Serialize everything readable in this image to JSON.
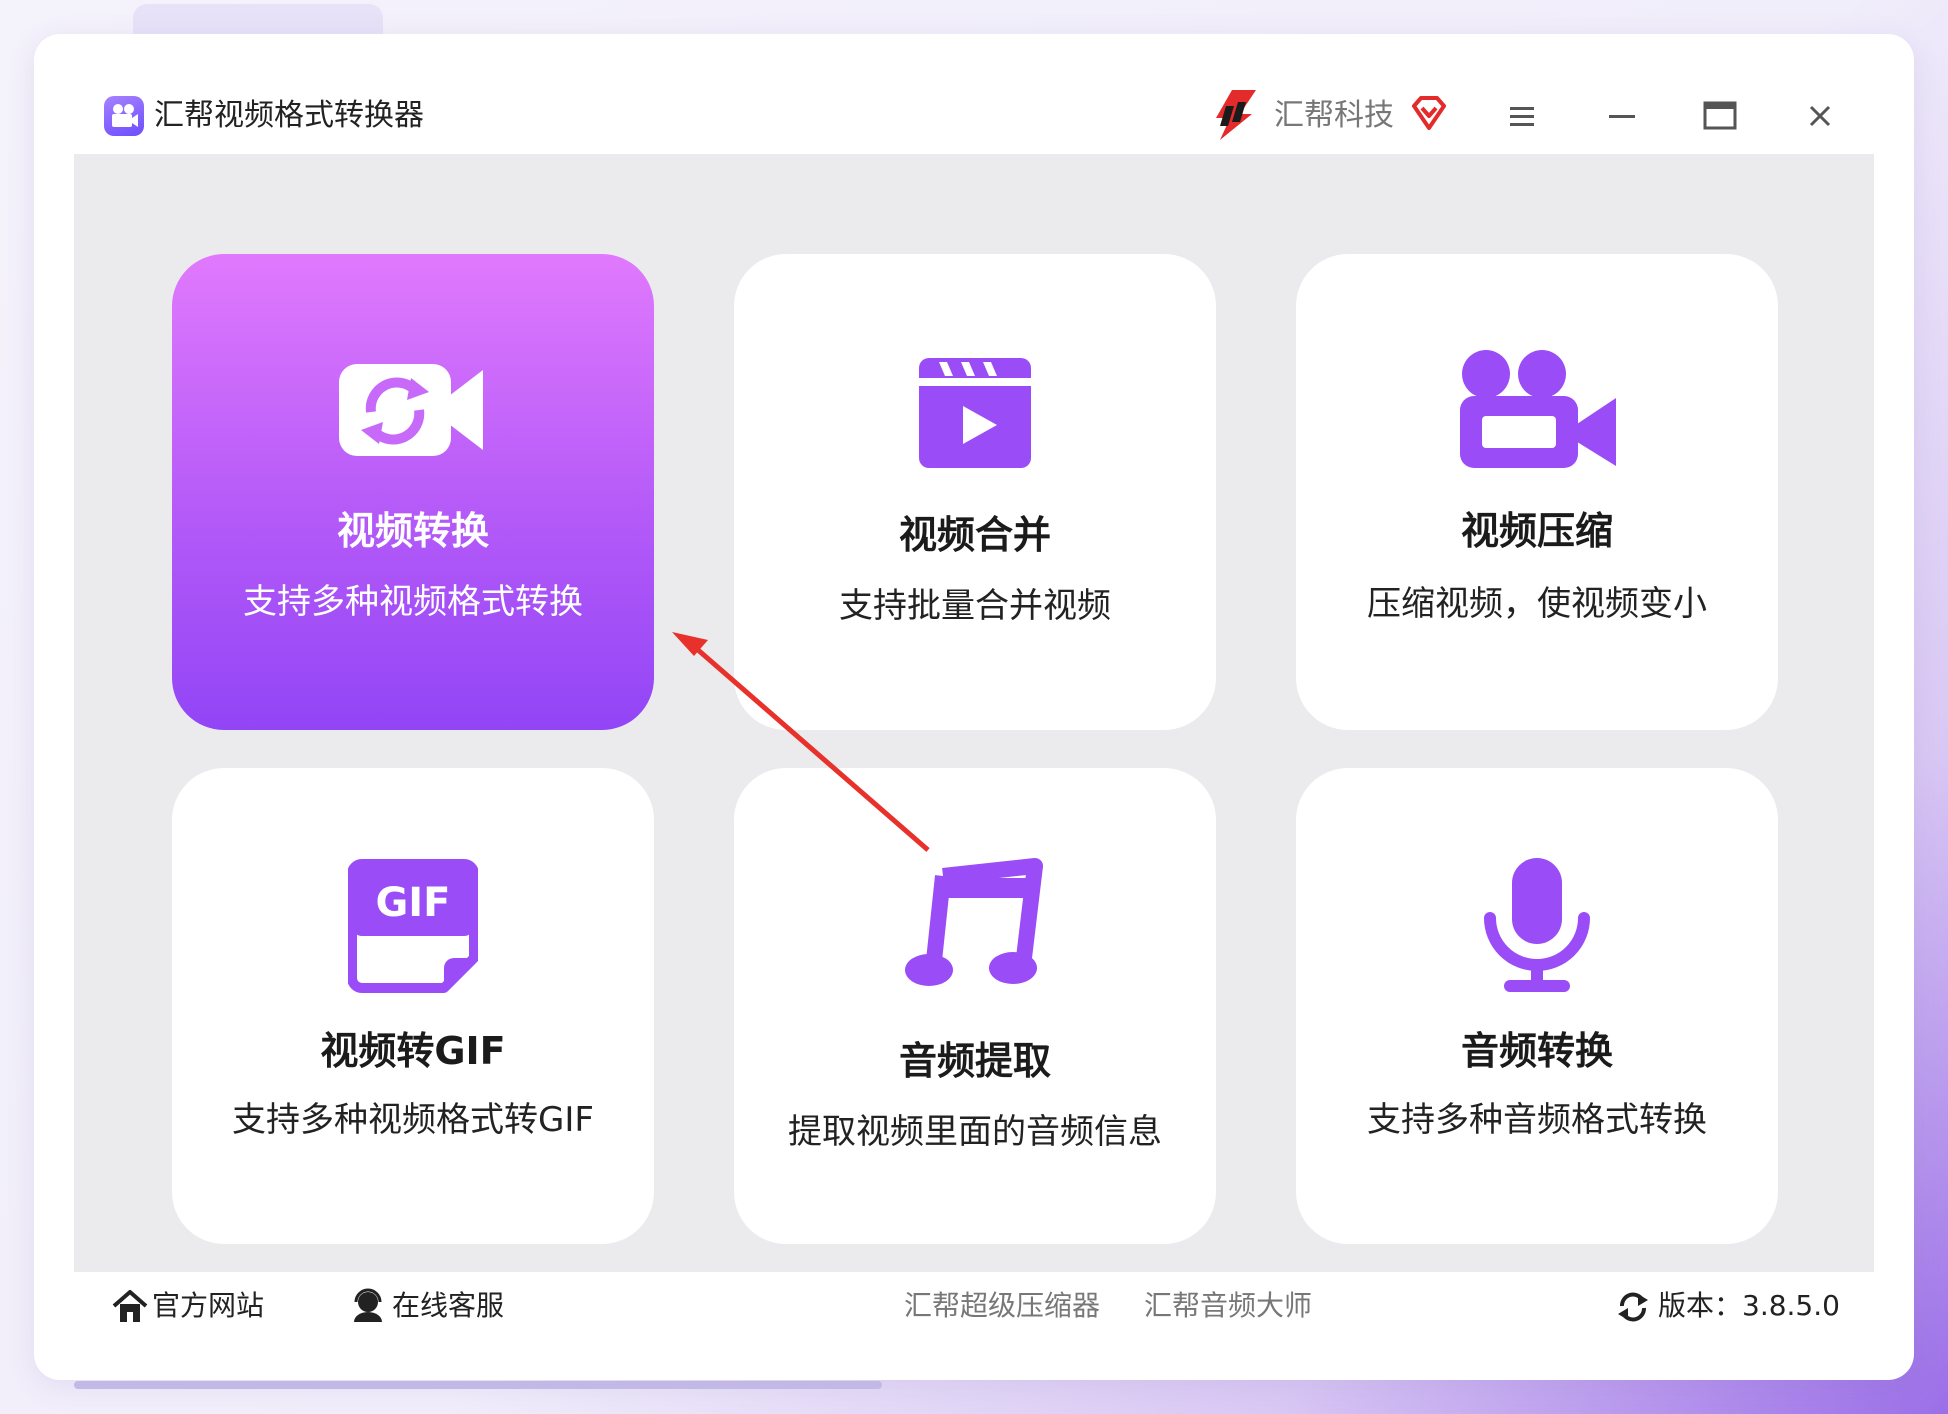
{
  "app": {
    "title": "汇帮视频格式转换器",
    "brand": "汇帮科技"
  },
  "colors": {
    "accent": "#9a4cf7",
    "active_card_top": "#e079fd",
    "active_card_bottom": "#9245f6",
    "annotation_arrow": "#e8312a"
  },
  "window_controls": [
    "menu-icon",
    "minimize-icon",
    "maximize-icon",
    "close-icon"
  ],
  "features": [
    {
      "icon": "video-convert-icon",
      "title": "视频转换",
      "desc": "支持多种视频格式转换",
      "active": true
    },
    {
      "icon": "clapperboard-play-icon",
      "title": "视频合并",
      "desc": "支持批量合并视频"
    },
    {
      "icon": "video-camera-icon",
      "title": "视频压缩",
      "desc": "压缩视频，使视频变小"
    },
    {
      "icon": "gif-file-icon",
      "title": "视频转GIF",
      "desc": "支持多种视频格式转GIF"
    },
    {
      "icon": "music-note-icon",
      "title": "音频提取",
      "desc": "提取视频里面的音频信息"
    },
    {
      "icon": "microphone-icon",
      "title": "音频转换",
      "desc": "支持多种音频格式转换"
    }
  ],
  "footer": {
    "website": "官方网站",
    "support": "在线客服",
    "link1": "汇帮超级压缩器",
    "link2": "汇帮音频大师",
    "version": "版本：3.8.5.0"
  }
}
